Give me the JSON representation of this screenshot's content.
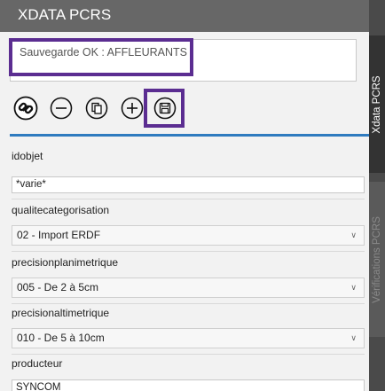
{
  "panel": {
    "title": "XDATA PCRS",
    "status_message": "Sauvegarde OK : AFFLEURANTS"
  },
  "toolbar": {
    "items": [
      {
        "name": "link-icon"
      },
      {
        "name": "minus-circle-icon"
      },
      {
        "name": "copy-icon"
      },
      {
        "name": "plus-circle-icon"
      },
      {
        "name": "save-icon"
      }
    ]
  },
  "fields": {
    "idobjet": {
      "label": "idobjet",
      "value": "*varie*"
    },
    "qualitecategorisation": {
      "label": "qualitecategorisation",
      "value": "02 - Import ERDF"
    },
    "precisionplanimetrique": {
      "label": "precisionplanimetrique",
      "value": "005 - De 2 à 5cm"
    },
    "precisionaltimetrique": {
      "label": "precisionaltimetrique",
      "value": "010 - De 5 à 10cm"
    },
    "producteur": {
      "label": "producteur",
      "value": "SYNCOM"
    }
  },
  "side_tabs": [
    {
      "label": "Xdata PCRS",
      "active": true
    },
    {
      "label": "Vérifications PCRS",
      "active": false
    }
  ],
  "colors": {
    "titlebar": "#676767",
    "highlight": "#5b2d91",
    "separator": "#2f7bbf"
  }
}
